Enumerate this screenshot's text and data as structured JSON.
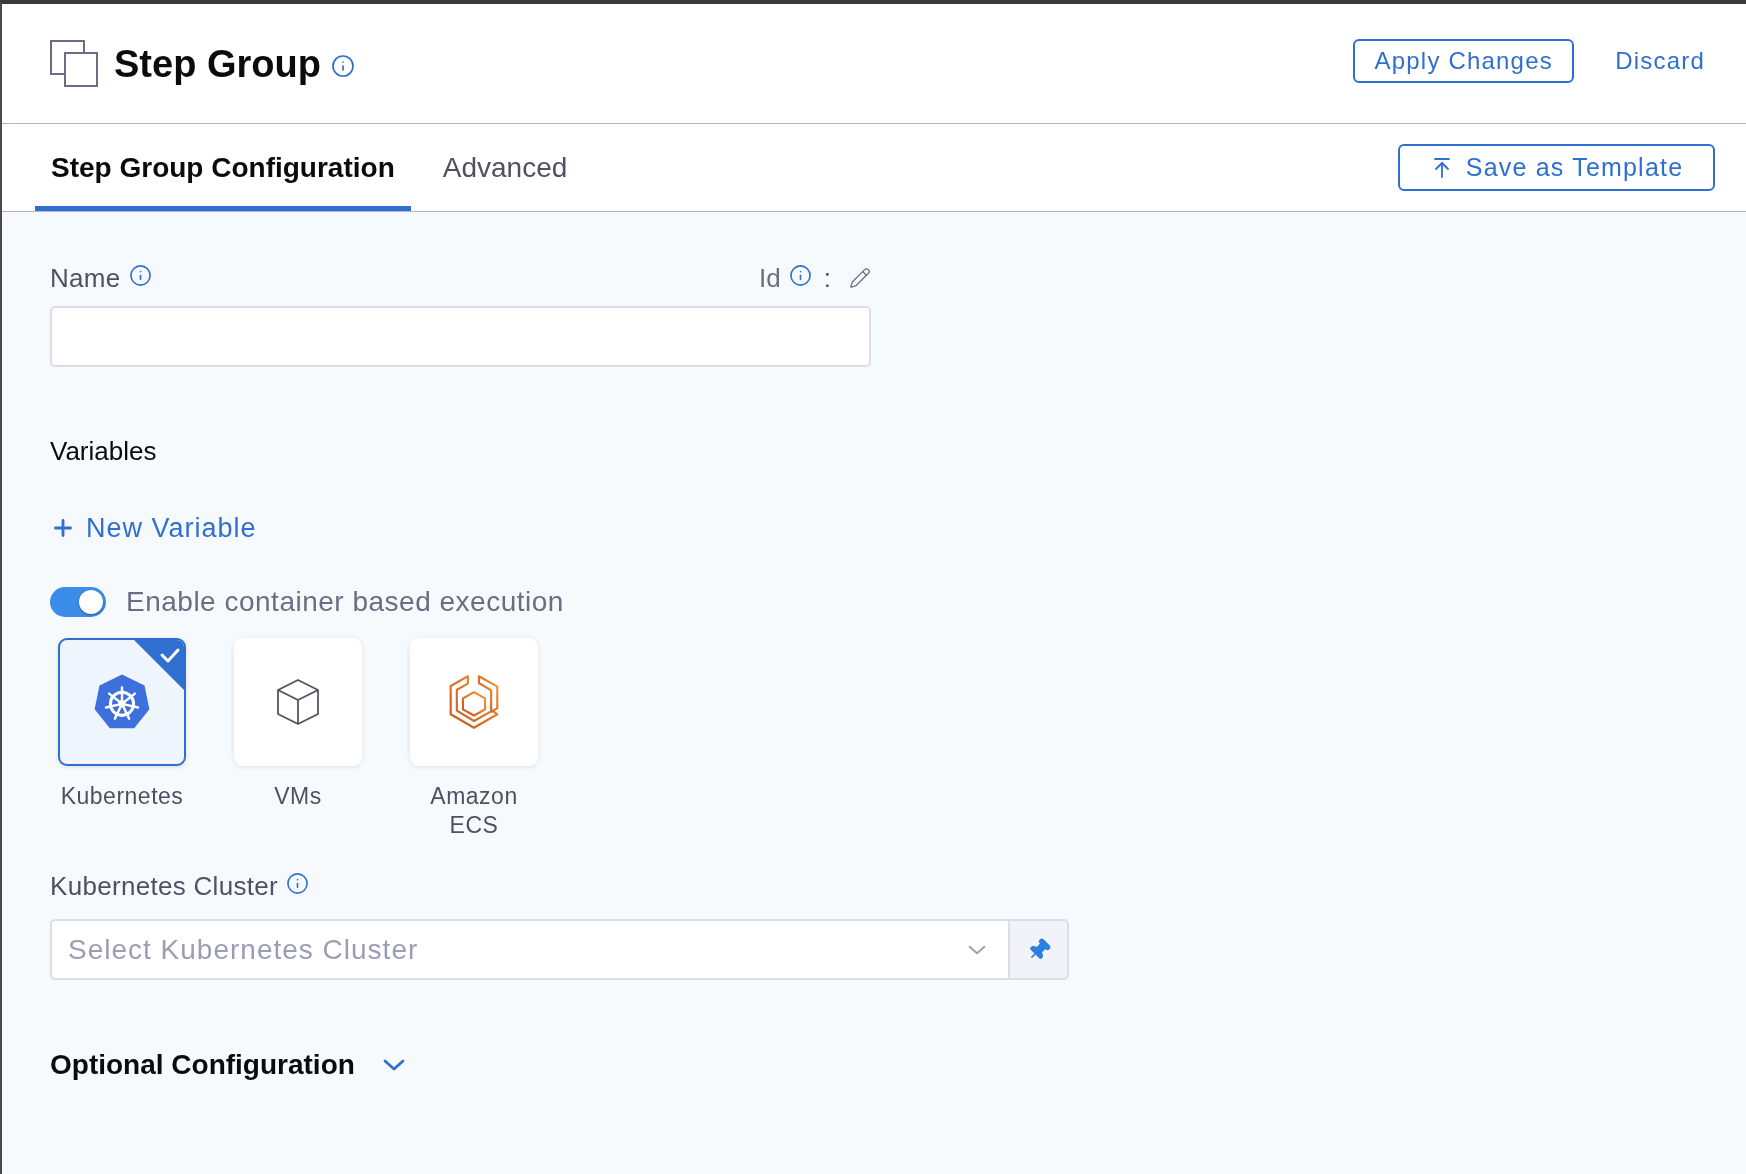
{
  "header": {
    "title": "Step Group",
    "buttons": [
      {
        "label": "Apply Changes",
        "kind": "outlined"
      },
      {
        "label": "Discard",
        "kind": "text"
      }
    ]
  },
  "tabs": [
    {
      "label": "Step Group Configuration",
      "selected": true
    },
    {
      "label": "Advanced",
      "selected": false
    }
  ],
  "save_template_button": {
    "label": "Save as Template"
  },
  "form": {
    "name_field": {
      "label": "Name"
    },
    "id": {
      "label": "Id",
      "separator": ":"
    },
    "variables": {
      "title": "Variables",
      "add_button": "New Variable"
    },
    "container_execution": {
      "label": "Enable container based execution",
      "on": true
    },
    "infrastructure_options": [
      {
        "label": "Kubernetes",
        "kind": "kubernetes",
        "selected": true
      },
      {
        "label": "VMs",
        "kind": "vms",
        "selected": false
      },
      {
        "label": "Amazon ECS",
        "kind": "ecs",
        "selected": false
      }
    ],
    "cluster_field": {
      "label": "Kubernetes Cluster",
      "placeholder": "Select Kubernetes Cluster"
    },
    "optional_configuration": {
      "title": "Optional Configuration",
      "expanded": false
    }
  }
}
